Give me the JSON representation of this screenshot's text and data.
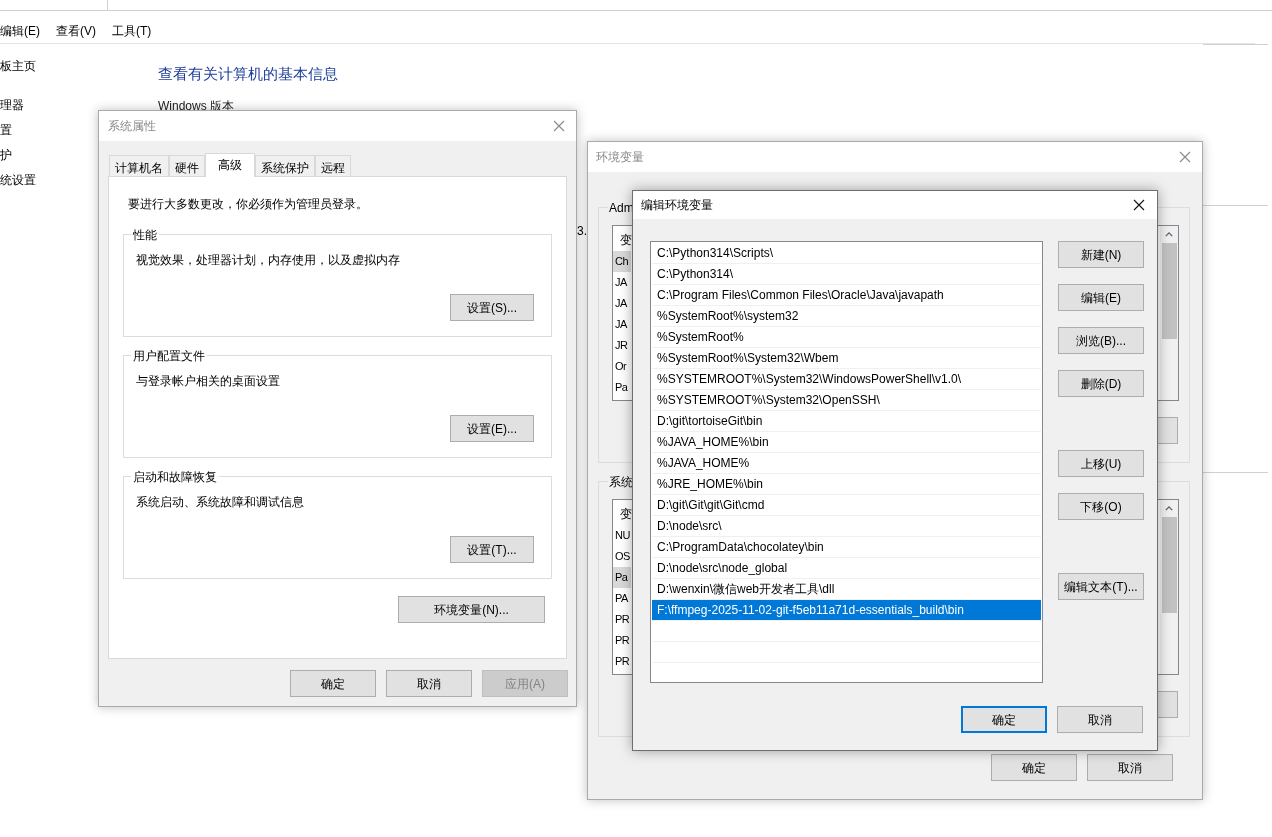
{
  "background": {
    "menu": [
      {
        "label": "编辑(E)"
      },
      {
        "label": "查看(V)"
      },
      {
        "label": "工具(T)"
      }
    ],
    "sidebar_links": [
      "板主页",
      "理器",
      "置",
      "护",
      "统设置"
    ],
    "heading": "查看有关计算机的基本信息",
    "section": "Windows 版本",
    "fragment": "3."
  },
  "system_properties": {
    "title": "系统属性",
    "tabs": [
      {
        "label": "计算机名",
        "selected": false
      },
      {
        "label": "硬件",
        "selected": false
      },
      {
        "label": "高级",
        "selected": true
      },
      {
        "label": "系统保护",
        "selected": false
      },
      {
        "label": "远程",
        "selected": false
      }
    ],
    "notice": "要进行大多数更改，你必须作为管理员登录。",
    "groups": [
      {
        "title": "性能",
        "description": "视觉效果，处理器计划，内存使用，以及虚拟内存",
        "button": "设置(S)..."
      },
      {
        "title": "用户配置文件",
        "description": "与登录帐户相关的桌面设置",
        "button": "设置(E)..."
      },
      {
        "title": "启动和故障恢复",
        "description": "系统启动、系统故障和调试信息",
        "button": "设置(T)..."
      }
    ],
    "env_button": "环境变量(N)...",
    "buttons": [
      {
        "label": "确定",
        "disabled": false
      },
      {
        "label": "取消",
        "disabled": false
      },
      {
        "label": "应用(A)",
        "disabled": true
      }
    ]
  },
  "environment_variables": {
    "title": "环境变量",
    "groups": [
      {
        "title": "Adm",
        "header": "变",
        "rows": [
          {
            "text": "Ch",
            "selected": true
          },
          {
            "text": "JA",
            "selected": false
          },
          {
            "text": "JA",
            "selected": false
          },
          {
            "text": "JA",
            "selected": false
          },
          {
            "text": "JR",
            "selected": false
          },
          {
            "text": "Or",
            "selected": false
          },
          {
            "text": "Pa",
            "selected": false
          }
        ]
      },
      {
        "title": "系统",
        "header": "变",
        "rows": [
          {
            "text": "NU",
            "selected": false
          },
          {
            "text": "OS",
            "selected": false
          },
          {
            "text": "Pa",
            "selected": true
          },
          {
            "text": "PA",
            "selected": false
          },
          {
            "text": "PR",
            "selected": false
          },
          {
            "text": "PR",
            "selected": false
          },
          {
            "text": "PR",
            "selected": false
          }
        ]
      }
    ],
    "buttons": [
      "确定",
      "取消"
    ]
  },
  "edit_dialog": {
    "title": "编辑环境变量",
    "paths": [
      {
        "text": "C:\\Python314\\Scripts\\",
        "selected": false
      },
      {
        "text": "C:\\Python314\\",
        "selected": false
      },
      {
        "text": "C:\\Program Files\\Common Files\\Oracle\\Java\\javapath",
        "selected": false
      },
      {
        "text": "%SystemRoot%\\system32",
        "selected": false
      },
      {
        "text": "%SystemRoot%",
        "selected": false
      },
      {
        "text": "%SystemRoot%\\System32\\Wbem",
        "selected": false
      },
      {
        "text": "%SYSTEMROOT%\\System32\\WindowsPowerShell\\v1.0\\",
        "selected": false
      },
      {
        "text": "%SYSTEMROOT%\\System32\\OpenSSH\\",
        "selected": false
      },
      {
        "text": "D:\\git\\tortoiseGit\\bin",
        "selected": false
      },
      {
        "text": "%JAVA_HOME%\\bin",
        "selected": false
      },
      {
        "text": "%JAVA_HOME%",
        "selected": false
      },
      {
        "text": "%JRE_HOME%\\bin",
        "selected": false
      },
      {
        "text": "D:\\git\\Git\\git\\Git\\cmd",
        "selected": false
      },
      {
        "text": "D:\\node\\src\\",
        "selected": false
      },
      {
        "text": "C:\\ProgramData\\chocolatey\\bin",
        "selected": false
      },
      {
        "text": "D:\\node\\src\\node_global",
        "selected": false
      },
      {
        "text": "D:\\wenxin\\微信web开发者工具\\dll",
        "selected": false
      },
      {
        "text": "F:\\ffmpeg-2025-11-02-git-f5eb11a71d-essentials_build\\bin",
        "selected": true
      }
    ],
    "side_buttons": [
      {
        "label": "新建(N)",
        "kind": "button"
      },
      {
        "label": "编辑(E)",
        "kind": "button"
      },
      {
        "label": "浏览(B)...",
        "kind": "button"
      },
      {
        "label": "删除(D)",
        "kind": "button"
      },
      {
        "kind": "gap"
      },
      {
        "label": "上移(U)",
        "kind": "button"
      },
      {
        "label": "下移(O)",
        "kind": "button"
      },
      {
        "kind": "gap"
      },
      {
        "label": "编辑文本(T)...",
        "kind": "button"
      }
    ],
    "ok": "确定",
    "cancel": "取消"
  }
}
